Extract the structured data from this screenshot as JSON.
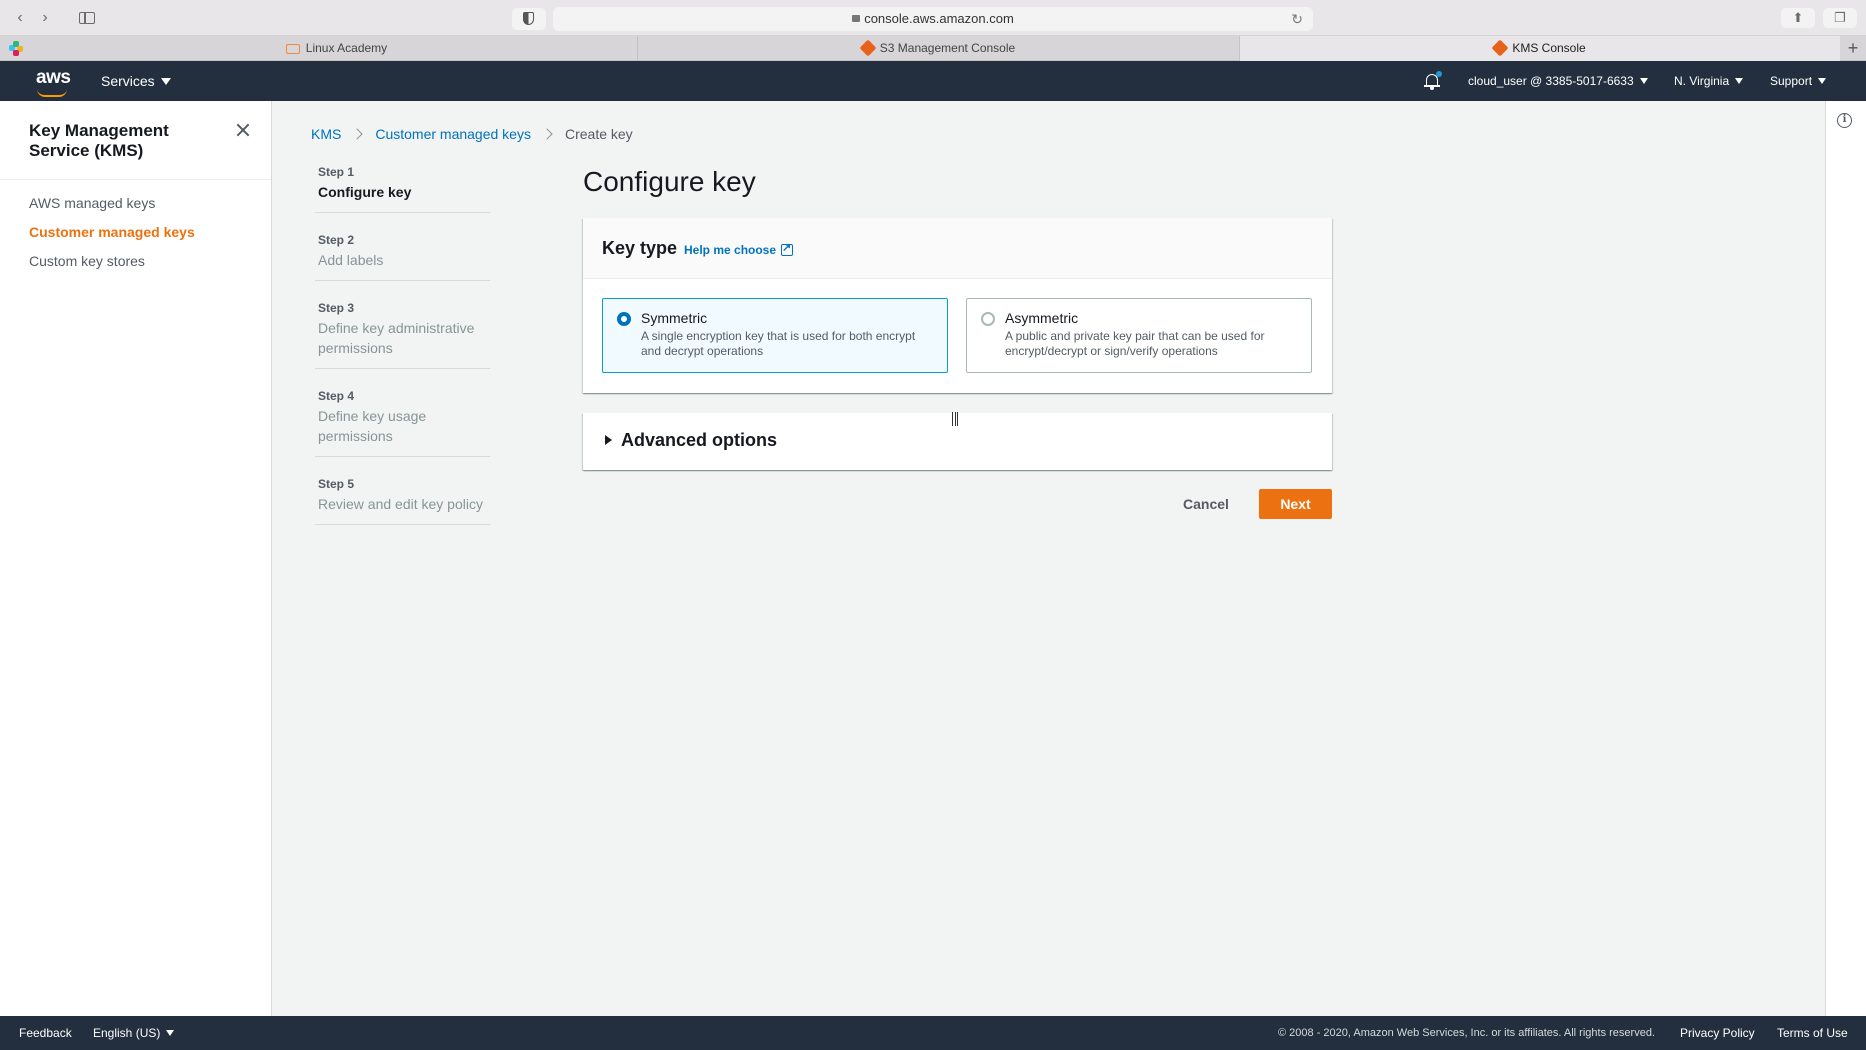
{
  "browser": {
    "url": "console.aws.amazon.com",
    "tabs": [
      {
        "label": "Linux Academy",
        "active": false
      },
      {
        "label": "S3 Management Console",
        "active": false
      },
      {
        "label": "KMS Console",
        "active": true
      }
    ]
  },
  "header": {
    "logo": "aws",
    "services_label": "Services",
    "account": "cloud_user @ 3385-5017-6633",
    "region": "N. Virginia",
    "support": "Support"
  },
  "sidebar": {
    "title": "Key Management Service (KMS)",
    "items": [
      {
        "label": "AWS managed keys",
        "active": false
      },
      {
        "label": "Customer managed keys",
        "active": true
      },
      {
        "label": "Custom key stores",
        "active": false
      }
    ]
  },
  "breadcrumb": {
    "items": [
      "KMS",
      "Customer managed keys"
    ],
    "current": "Create key"
  },
  "steps": [
    {
      "number": "Step 1",
      "label": "Configure key",
      "current": true
    },
    {
      "number": "Step 2",
      "label": "Add labels",
      "current": false
    },
    {
      "number": "Step 3",
      "label": "Define key administrative permissions",
      "current": false
    },
    {
      "number": "Step 4",
      "label": "Define key usage permissions",
      "current": false
    },
    {
      "number": "Step 5",
      "label": "Review and edit key policy",
      "current": false
    }
  ],
  "main": {
    "page_title": "Configure key",
    "key_type": {
      "title": "Key type",
      "help_link": "Help me choose",
      "options": [
        {
          "label": "Symmetric",
          "description": "A single encryption key that is used for both encrypt and decrypt operations",
          "selected": true
        },
        {
          "label": "Asymmetric",
          "description": "A public and private key pair that can be used for encrypt/decrypt or sign/verify operations",
          "selected": false
        }
      ]
    },
    "advanced_options": "Advanced options",
    "cancel_label": "Cancel",
    "next_label": "Next"
  },
  "footer": {
    "feedback": "Feedback",
    "language": "English (US)",
    "copyright": "© 2008 - 2020, Amazon Web Services, Inc. or its affiliates. All rights reserved.",
    "privacy": "Privacy Policy",
    "terms": "Terms of Use"
  },
  "colors": {
    "header_bg": "#232f3e",
    "accent": "#ec7211",
    "link": "#0073bb",
    "selected_border": "#00a1c9"
  },
  "icons": [
    "back-icon",
    "forward-icon",
    "sidebar-toggle-icon",
    "shield-icon",
    "lock-icon",
    "reload-icon",
    "share-icon",
    "tabs-overview-icon",
    "new-tab-icon",
    "bell-icon",
    "close-icon",
    "info-icon",
    "external-link-icon"
  ]
}
